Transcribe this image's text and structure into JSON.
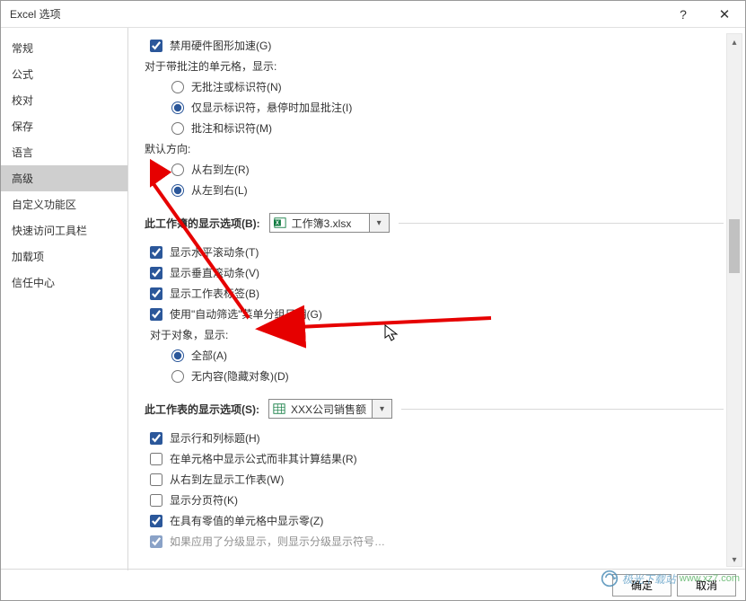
{
  "window": {
    "title": "Excel 选项",
    "help": "?",
    "close": "✕"
  },
  "sidebar": {
    "items": [
      {
        "label": "常规"
      },
      {
        "label": "公式"
      },
      {
        "label": "校对"
      },
      {
        "label": "保存"
      },
      {
        "label": "语言"
      },
      {
        "label": "高级",
        "selected": true
      },
      {
        "label": "自定义功能区"
      },
      {
        "label": "快速访问工具栏"
      },
      {
        "label": "加载项"
      },
      {
        "label": "信任中心"
      }
    ]
  },
  "top_checkbox": "禁用硬件图形加速(G)",
  "group_comment": {
    "title": "对于带批注的单元格，显示:",
    "opts": [
      "无批注或标识符(N)",
      "仅显示标识符，悬停时加显批注(I)",
      "批注和标识符(M)"
    ]
  },
  "group_dir": {
    "title": "默认方向:",
    "opts": [
      "从右到左(R)",
      "从左到右(L)"
    ]
  },
  "workbook_section": {
    "title": "此工作簿的显示选项(B):",
    "combo_value": "工作簿3.xlsx",
    "checks": [
      "显示水平滚动条(T)",
      "显示垂直滚动条(V)",
      "显示工作表标签(B)",
      "使用\"自动筛选\"菜单分组日期(G)"
    ],
    "objects_title": "对于对象，显示:",
    "object_opts": [
      "全部(A)",
      "无内容(隐藏对象)(D)"
    ]
  },
  "sheet_section": {
    "title": "此工作表的显示选项(S):",
    "combo_value": "XXX公司销售额",
    "checks": [
      "显示行和列标题(H)",
      "在单元格中显示公式而非其计算结果(R)",
      "从右到左显示工作表(W)",
      "显示分页符(K)",
      "在具有零值的单元格中显示零(Z)",
      "如果应用了分级显示，则显示分级显示符号…"
    ]
  },
  "footer": {
    "ok": "确定",
    "cancel": "取消"
  },
  "watermark": {
    "brand": "极光下载站",
    "url": "www.xz7.com"
  }
}
